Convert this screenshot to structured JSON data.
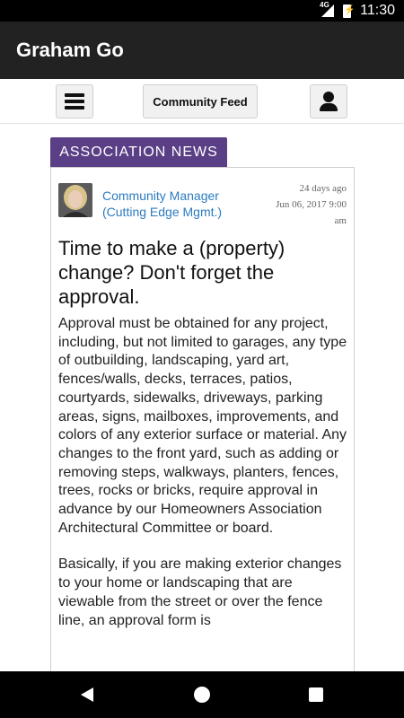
{
  "status_bar": {
    "network": "4G",
    "time": "11:30"
  },
  "app": {
    "title": "Graham Go"
  },
  "toolbar": {
    "feed_label": "Community Feed"
  },
  "section": {
    "label": "ASSOCIATION NEWS"
  },
  "post": {
    "author_line1": "Community Manager",
    "author_line2": "(Cutting Edge Mgmt.)",
    "relative_time": "24 days ago",
    "date_line1": "Jun 06, 2017 9:00",
    "date_line2": "am",
    "title": "Time to make a (property) change? Don't forget the approval.",
    "paragraphs": [
      "Approval must be obtained for any project, including, but not limited to garages, any type of outbuilding, landscaping, yard art, fences/walls, decks, terraces, patios, courtyards, sidewalks, driveways, parking areas, signs, mailboxes, improvements, and colors of any exterior surface or material. Any changes to the front yard, such as adding or removing steps, walkways, planters, fences, trees, rocks or bricks, require approval in advance by our Homeowners Association Architectural Committee or board.",
      "Basically, if you are making exterior changes to your home or landscaping that are viewable from the street or over the fence line, an approval form is"
    ]
  }
}
